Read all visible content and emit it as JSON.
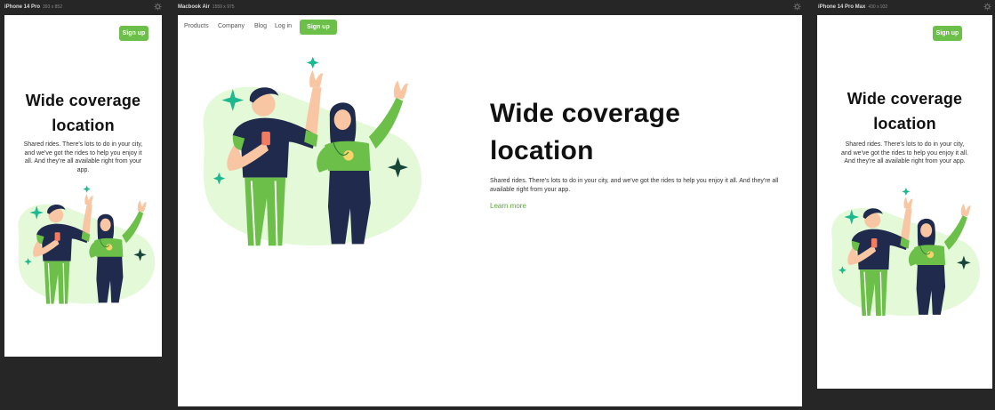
{
  "frames": {
    "phone_left": {
      "name": "iPhone 14 Pro",
      "size": "393 x 852"
    },
    "desktop": {
      "name": "Macbook Air",
      "size": "1559 x 975"
    },
    "phone_right": {
      "name": "iPhone 14 Pro Max",
      "size": "430 x 932"
    }
  },
  "nav": {
    "items": [
      "Products",
      "Company",
      "Blog",
      "Log in"
    ],
    "signup_label": "Sign up"
  },
  "hero": {
    "title_line1": "Wide coverage",
    "title_line2": "location",
    "description": "Shared rides. There's lots to do in your city, and we've got the rides to help you enjoy it all. And they're all available right from your app.",
    "learn_more": "Learn more"
  },
  "colors": {
    "accent": "#6cc04a",
    "blob": "#e3f9d8",
    "navy": "#1f2a4d",
    "sparkle_teal": "#1eb88f",
    "sparkle_dark": "#17453a"
  },
  "icons": {
    "settings": "gear-icon"
  }
}
